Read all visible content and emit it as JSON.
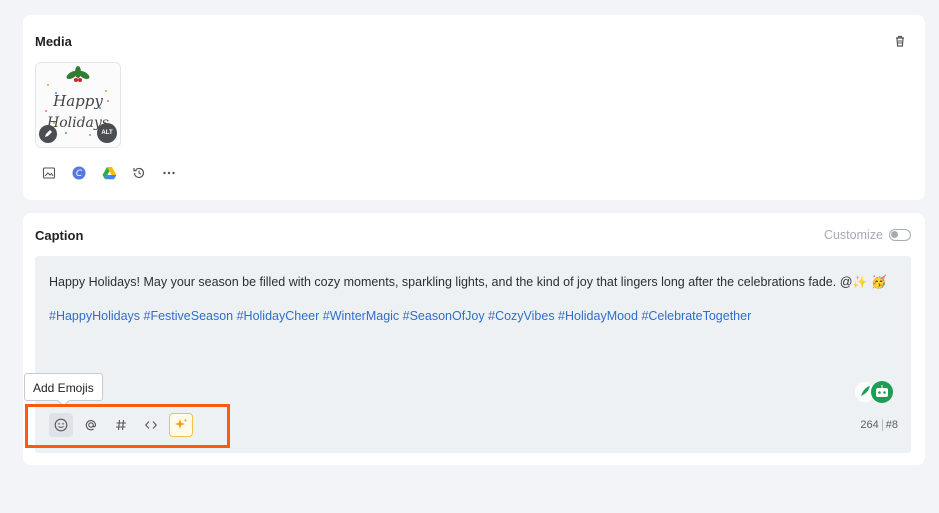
{
  "media": {
    "title": "Media",
    "thumbnail": {
      "art_line1": "Happy",
      "art_line2": "Holidays",
      "alt_badge": "ALT"
    },
    "tools": [
      "upload-image-icon",
      "canva-icon",
      "google-drive-icon",
      "history-icon",
      "more-icon"
    ]
  },
  "caption": {
    "title": "Caption",
    "customize_label": "Customize",
    "customize_enabled": false,
    "text": "Happy Holidays! May your season be filled with cozy moments, sparkling lights, and the kind of joy that lingers long after the celebrations fade. @✨ 🥳",
    "hashtags": "#HappyHolidays #FestiveSeason #HolidayCheer #WinterMagic #SeasonOfJoy #CozyVibes #HolidayMood #CelebrateTogether",
    "tooltip": "Add Emojis",
    "tools": [
      "emoji-icon",
      "mention-icon",
      "hashtag-icon",
      "code-icon",
      "ai-sparkle-icon"
    ],
    "char_count": "264",
    "hashtag_count": "#8"
  },
  "colors": {
    "hashtag": "#2f6fc7",
    "highlight": "#ff5a12",
    "bot_badge": "#1f9d55"
  }
}
